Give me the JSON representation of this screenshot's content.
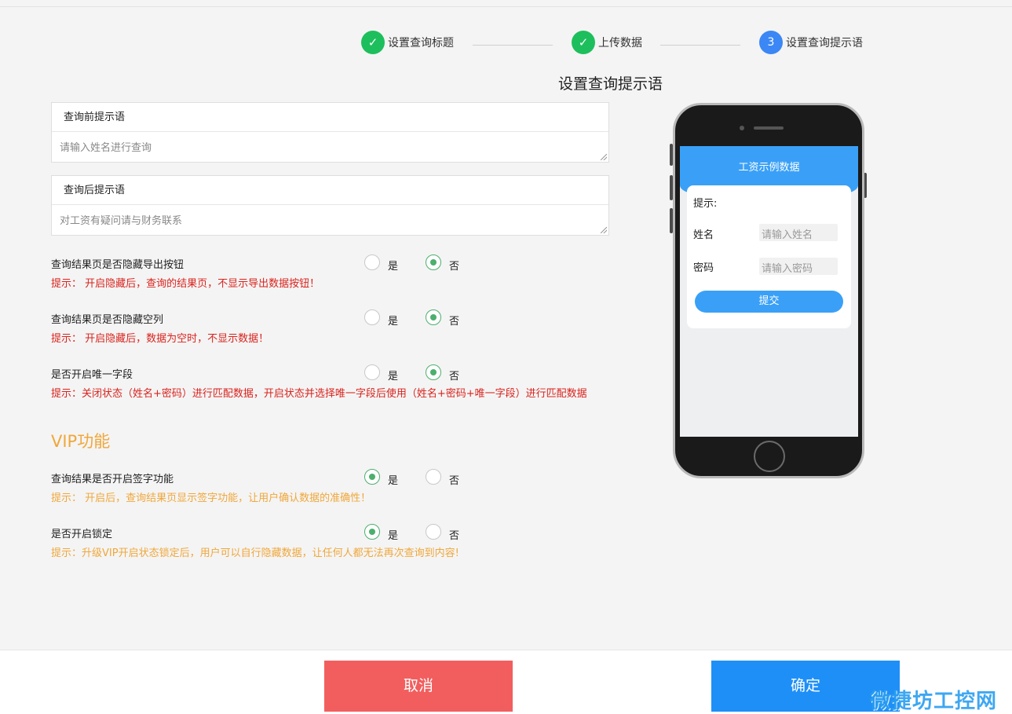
{
  "steps": [
    {
      "number": "✓",
      "label": "设置查询标题",
      "status": "done"
    },
    {
      "number": "✓",
      "label": "上传数据",
      "status": "done"
    },
    {
      "number": "3",
      "label": "设置查询提示语",
      "status": "active"
    }
  ],
  "section_title": "设置查询提示语",
  "before_tip": {
    "label": "查询前提示语",
    "placeholder": "请输入姓名进行查询"
  },
  "after_tip": {
    "label": "查询后提示语",
    "placeholder": "对工资有疑问请与财务联系"
  },
  "radio_labels": {
    "yes": "是",
    "no": "否"
  },
  "options": [
    {
      "label": "查询结果页是否隐藏导出按钮",
      "hint": "提示： 开启隐藏后，查询的结果页，不显示导出数据按钮！",
      "selected": "否"
    },
    {
      "label": "查询结果页是否隐藏空列",
      "hint": "提示： 开启隐藏后，数据为空时，不显示数据！",
      "selected": "否"
    },
    {
      "label": "是否开启唯一字段",
      "hint": "提示：关闭状态（姓名+密码）进行匹配数据，开启状态并选择唯一字段后使用（姓名+密码+唯一字段）进行匹配数据",
      "selected": "否"
    }
  ],
  "vip": {
    "title": "VIP功能",
    "options": [
      {
        "label": "查询结果是否开启签字功能",
        "hint": "提示： 开启后，查询结果页显示签字功能，让用户确认数据的准确性！",
        "selected": "是"
      },
      {
        "label": "是否开启锁定",
        "hint": "提示：升级VIP开启状态锁定后，用户可以自行隐藏数据，让任何人都无法再次查询到内容!",
        "selected": "是"
      }
    ]
  },
  "preview": {
    "header": "工资示例数据",
    "tip_label": "提示:",
    "name_label": "姓名",
    "name_placeholder": "请输入姓名",
    "password_label": "密码",
    "password_placeholder": "请输入密码",
    "submit": "提交"
  },
  "footer": {
    "cancel": "取消",
    "confirm": "确定"
  },
  "watermark": "微捷坊工控网",
  "colors": {
    "done": "#1dbf5c",
    "active": "#3b87f5",
    "hint_red": "#d9231d",
    "vip_orange": "#f0a73a",
    "radio_on": "#4caf6d",
    "cancel": "#f25e5e",
    "confirm": "#1e8ff7"
  }
}
